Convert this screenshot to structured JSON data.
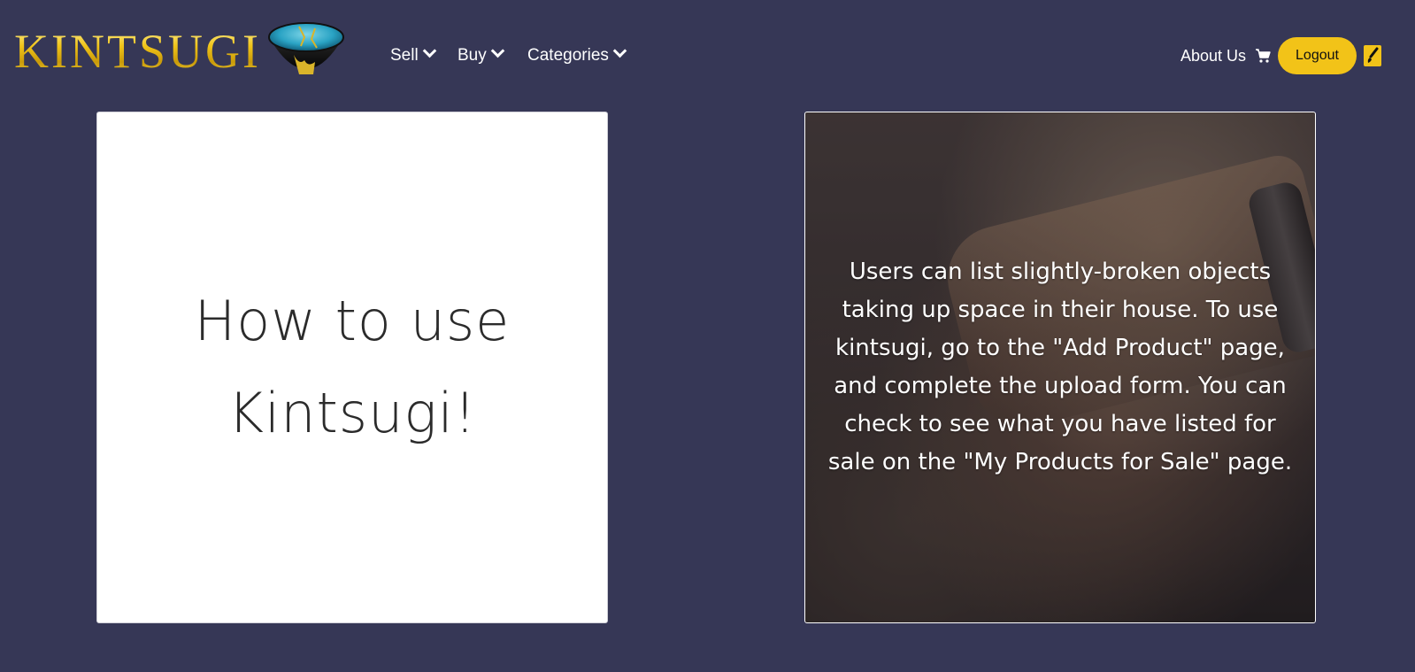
{
  "header": {
    "brand_name": "KINTSUGI",
    "brand_logo": "kintsugi-bowl",
    "nav": [
      {
        "label": "Sell",
        "icon": "chevron-down-icon"
      },
      {
        "label": "Buy",
        "icon": "chevron-down-icon"
      },
      {
        "label": "Categories",
        "icon": "chevron-down-icon"
      }
    ],
    "about_label": "About Us",
    "cart_icon": "cart-icon",
    "logout_label": "Logout",
    "theme_icon": "paintbrush-icon"
  },
  "main": {
    "left_card": {
      "heading": "How to use Kintsugi!"
    },
    "right_card": {
      "background": "glass-jar-photo",
      "text": "Users can list slightly-broken objects taking up space in their house. To use kintsugi, go to the \"Add Product\" page, and complete the upload form. You can check to see what you have listed for sale on the \"My Products for Sale\" page."
    }
  },
  "colors": {
    "background": "#363756",
    "accent": "#f2c318",
    "card_left": "#ffffff",
    "text_light": "#ffffff"
  }
}
